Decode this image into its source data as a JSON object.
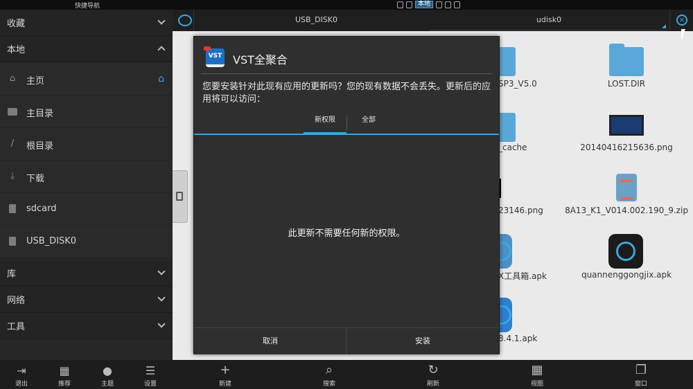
{
  "statusbar": {
    "nav_label": "快捷导航",
    "local_label": "本地"
  },
  "sidebar": {
    "favorites": "收藏",
    "local": "本地",
    "items": [
      {
        "label": "主页",
        "icon": "home-icon"
      },
      {
        "label": "主目录",
        "icon": "folder-icon"
      },
      {
        "label": "根目录",
        "icon": "slash-icon"
      },
      {
        "label": "下载",
        "icon": "download-icon"
      },
      {
        "label": "sdcard",
        "icon": "sdcard-icon"
      },
      {
        "label": "USB_DISK0",
        "icon": "usb-icon"
      }
    ],
    "library": "库",
    "network": "网络",
    "tools": "工具",
    "bottom": [
      {
        "label": "退出",
        "icon": "exit-icon"
      },
      {
        "label": "推荐",
        "icon": "gift-icon"
      },
      {
        "label": "主题",
        "icon": "palette-icon"
      },
      {
        "label": "设置",
        "icon": "sliders-icon"
      }
    ]
  },
  "tabbar": {
    "tab1": "USB_DISK0",
    "tab2": "udisk0"
  },
  "files": [
    {
      "label": "SP3_V5.0",
      "type": "folder"
    },
    {
      "label": "LOST.DIR",
      "type": "folder"
    },
    {
      "label": "_cache",
      "type": "folder"
    },
    {
      "label": "20140416215636.png",
      "type": "image"
    },
    {
      "label": "23146.png",
      "type": "image"
    },
    {
      "label": "8A13_K1_V014.002.190_9.zip",
      "type": "zip"
    },
    {
      "label": "X工具箱.apk",
      "type": "apk"
    },
    {
      "label": "quannenggongjix.apk",
      "type": "apk"
    },
    {
      "label": "8.4.1.apk",
      "type": "apk"
    }
  ],
  "bottom_main": [
    {
      "label": "新建",
      "icon": "plus-icon"
    },
    {
      "label": "搜索",
      "icon": "search-icon"
    },
    {
      "label": "刷新",
      "icon": "refresh-icon"
    },
    {
      "label": "视图",
      "icon": "grid-icon"
    },
    {
      "label": "窗口",
      "icon": "window-icon"
    }
  ],
  "dialog": {
    "logo_text": "VST",
    "title": "VST全聚合",
    "message": "您要安装针对此现有应用的更新吗？您的现有数据不会丢失。更新后的应用将可以访问：",
    "tab_new": "新权限",
    "tab_all": "全部",
    "body": "此更新不需要任何新的权限。",
    "cancel": "取消",
    "install": "安装"
  },
  "colors": {
    "accent": "#36a7de",
    "folder": "#5aa8d8"
  }
}
